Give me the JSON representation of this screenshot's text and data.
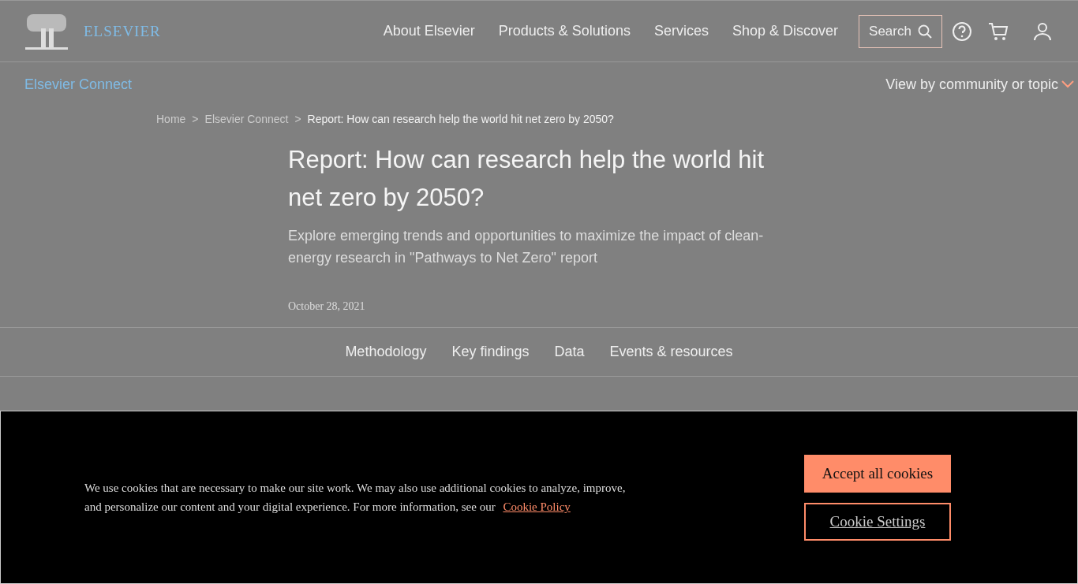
{
  "header": {
    "logo_text": "ELSEVIER",
    "nav": [
      "About Elsevier",
      "Products & Solutions",
      "Services",
      "Shop & Discover"
    ],
    "search": {
      "label": "Search"
    }
  },
  "subnav": {
    "title": "Elsevier Connect",
    "menu": "View by community or topic"
  },
  "breadcrumb": [
    "Home",
    "Elsevier Connect",
    "Report: How can research help the world hit net zero by 2050?"
  ],
  "breadcrumb_separator": ">",
  "article": {
    "title": "Report: How can research help the world hit net zero by 2050?",
    "subtitle": "Explore emerging trends and opportunities to maximize the impact of clean-energy research in \"Pathways to Net Zero\" report",
    "date": "October 28, 2021"
  },
  "section_tabs": [
    "Methodology",
    "Key findings",
    "Data",
    "Events & resources"
  ],
  "cookie_banner": {
    "text": "We use cookies that are necessary to make our site work. We may also use additional cookies to analyze, improve, and personalize our content and your digital experience. For more information, see our",
    "link": "Cookie Policy",
    "buttons": [
      {
        "label": "Accept all cookies",
        "kind": "primary"
      },
      {
        "label": "Cookie Settings",
        "kind": "outline"
      }
    ]
  }
}
